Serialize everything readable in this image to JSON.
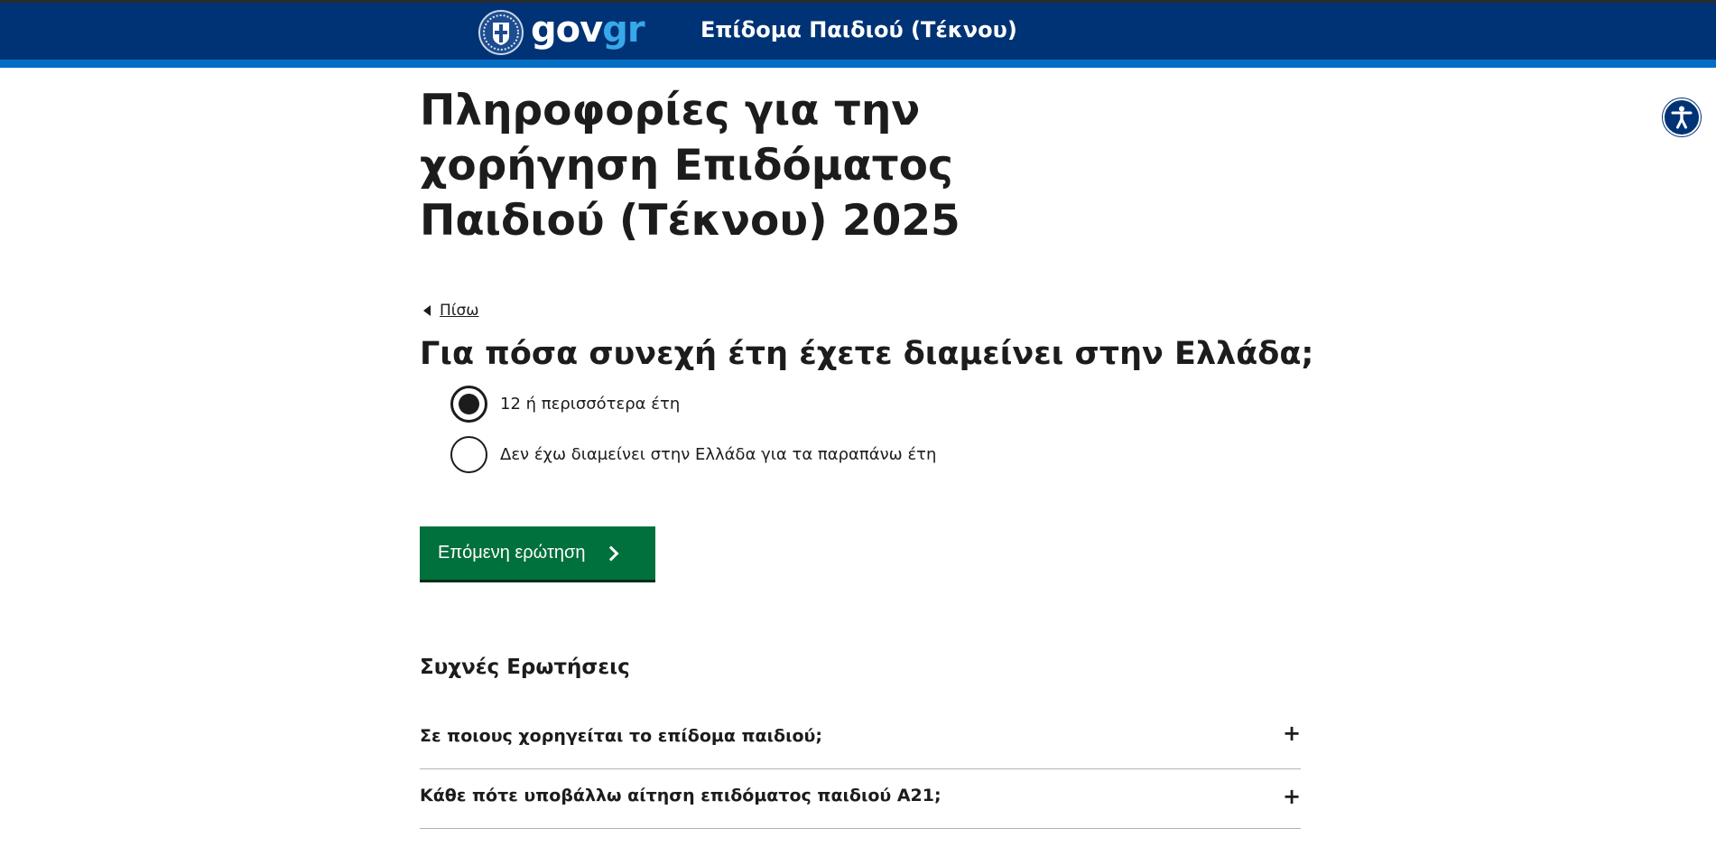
{
  "header": {
    "logo_gov": "gov",
    "logo_gr": "gr",
    "service_name": "Επίδομα Παιδιού (Τέκνου)",
    "colors": {
      "bar": "#003375",
      "stripe": "#046ec5",
      "logo_accent": "#37a8e8"
    }
  },
  "page": {
    "title": "Πληροφορίες για την χορήγηση Επιδόματος Παιδιού (Τέκνου) 2025",
    "back_label": "Πίσω"
  },
  "form": {
    "question": "Για πόσα συνεχή έτη έχετε διαμείνει στην Ελλάδα;",
    "options": [
      {
        "label": "12 ή περισσότερα έτη",
        "selected": true
      },
      {
        "label": "Δεν έχω διαμείνει στην Ελλάδα για τα παραπάνω έτη",
        "selected": false
      }
    ],
    "next_button": "Επόμενη ερώτηση",
    "button_color": "#00703c"
  },
  "faq": {
    "title": "Συχνές Ερωτήσεις",
    "items": [
      {
        "question": "Σε ποιους χορηγείται το επίδομα παιδιού;",
        "icon": "plus-icon"
      },
      {
        "question": "Κάθε πότε υποβάλλω αίτηση επιδόματος παιδιού Α21;",
        "icon": "plus-icon"
      }
    ]
  },
  "accessibility": {
    "icon": "accessibility-icon"
  }
}
